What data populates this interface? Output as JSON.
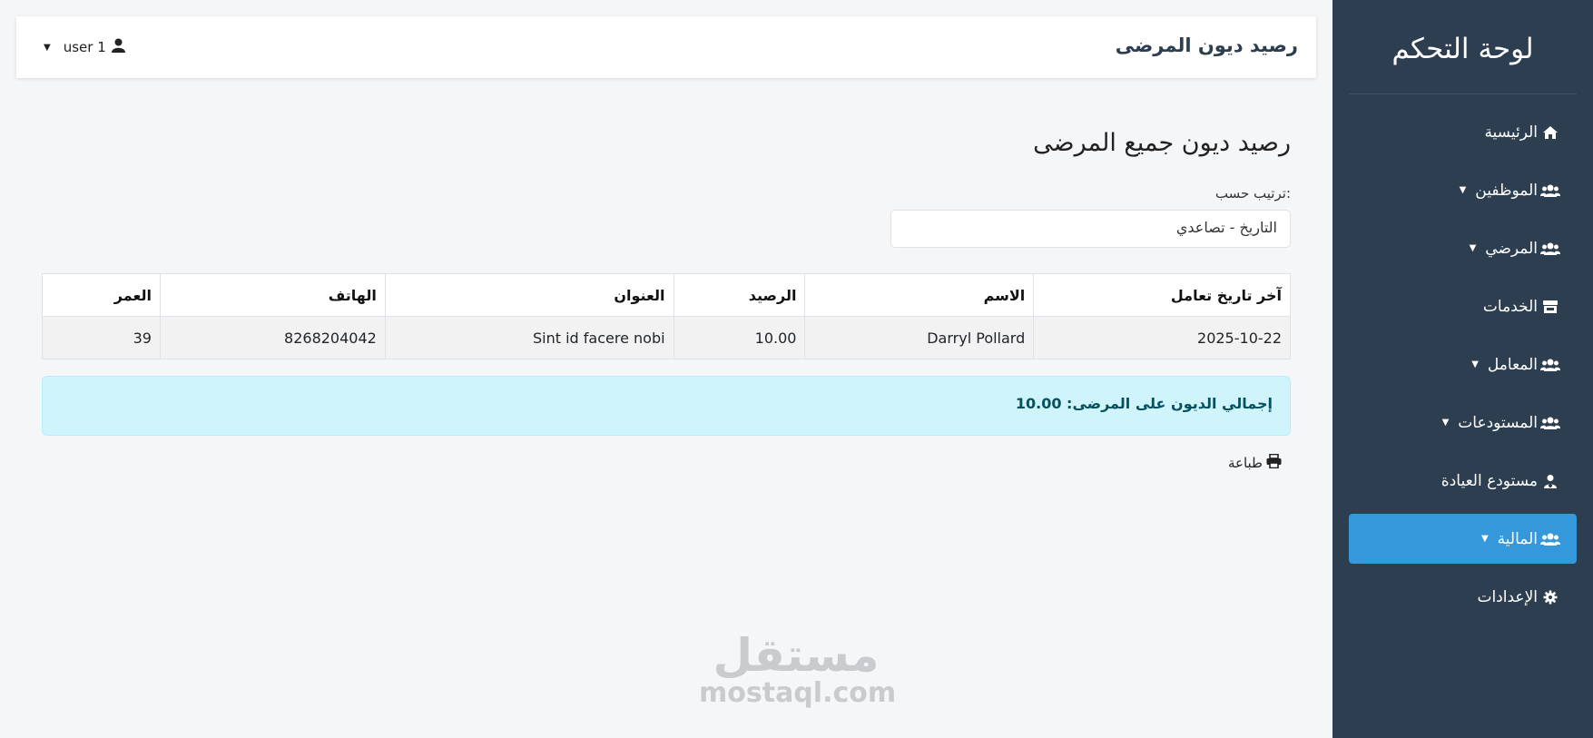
{
  "sidebar": {
    "title": "لوحة التحكم",
    "items": [
      {
        "label": "الرئيسية",
        "icon": "home-icon",
        "caret": false,
        "active": false
      },
      {
        "label": "الموظفين",
        "icon": "users-icon",
        "caret": true,
        "active": false
      },
      {
        "label": "المرضي",
        "icon": "users-icon",
        "caret": true,
        "active": false
      },
      {
        "label": "الخدمات",
        "icon": "store-icon",
        "caret": false,
        "active": false
      },
      {
        "label": "المعامل",
        "icon": "users-icon",
        "caret": true,
        "active": false
      },
      {
        "label": "المستودعات",
        "icon": "users-icon",
        "caret": true,
        "active": false
      },
      {
        "label": "مستودع العيادة",
        "icon": "user-md-icon",
        "caret": false,
        "active": false
      },
      {
        "label": "المالية",
        "icon": "users-icon",
        "caret": true,
        "active": true
      },
      {
        "label": "الإعدادات",
        "icon": "gear-icon",
        "caret": false,
        "active": false
      }
    ]
  },
  "header": {
    "title": "رصيد ديون المرضى",
    "user_label": "user 1"
  },
  "main": {
    "heading": "رصيد ديون جميع المرضى",
    "sort_label": "ترتيب حسب:",
    "sort_value": "التاريخ - تصاعدي",
    "table": {
      "headers": [
        "آخر تاريخ تعامل",
        "الاسم",
        "الرصيد",
        "العنوان",
        "الهاتف",
        "العمر"
      ],
      "rows": [
        [
          "2025-10-22",
          "Darryl Pollard",
          "10.00",
          "Sint id facere nobi",
          "8268204042",
          "39"
        ]
      ]
    },
    "total_text": "إجمالي الديون على المرضى: 10.00",
    "print_label": "طباعة"
  },
  "watermark": {
    "arabic": "مستقل",
    "latin": "mostaql.com"
  },
  "colors": {
    "sidebar_bg": "#2c3e50",
    "active_item": "#3498db",
    "info_bg": "#cff4fc",
    "info_text": "#055160"
  }
}
